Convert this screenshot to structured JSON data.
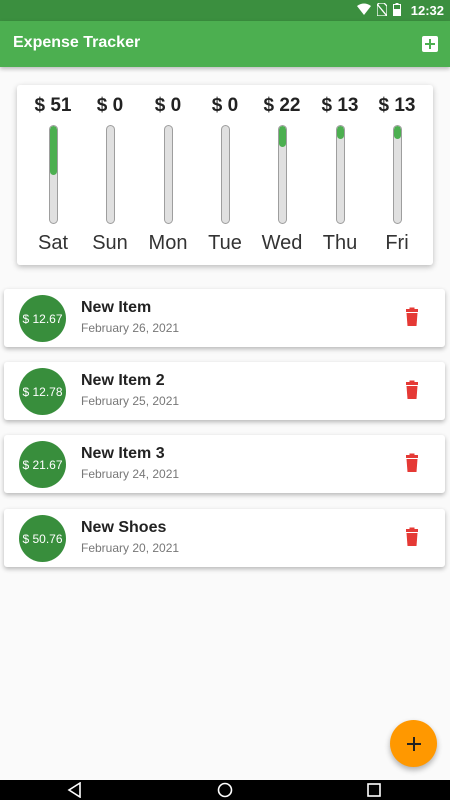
{
  "status_bar": {
    "time": "12:32",
    "icons": [
      "wifi-icon",
      "no-sim-icon",
      "battery-icon"
    ]
  },
  "app_bar": {
    "title": "Expense Tracker",
    "action_icon": "add-box-icon"
  },
  "colors": {
    "primary": "#4caf50",
    "dark_primary": "#388e3c",
    "accent": "#ff9800",
    "delete": "#e53935"
  },
  "chart": {
    "days": [
      {
        "day": "Sat",
        "amount": "$ 51",
        "fraction": 0.5
      },
      {
        "day": "Sun",
        "amount": "$ 0",
        "fraction": 0
      },
      {
        "day": "Mon",
        "amount": "$ 0",
        "fraction": 0
      },
      {
        "day": "Tue",
        "amount": "$ 0",
        "fraction": 0
      },
      {
        "day": "Wed",
        "amount": "$ 22",
        "fraction": 0.22
      },
      {
        "day": "Thu",
        "amount": "$ 13",
        "fraction": 0.13
      },
      {
        "day": "Fri",
        "amount": "$ 13",
        "fraction": 0.13
      }
    ]
  },
  "transactions": [
    {
      "amount": "$ 12.67",
      "title": "New Item",
      "date": "February 26, 2021"
    },
    {
      "amount": "$ 12.78",
      "title": "New Item 2",
      "date": "February 25, 2021"
    },
    {
      "amount": "$ 21.67",
      "title": "New Item 3",
      "date": "February 24, 2021"
    },
    {
      "amount": "$ 50.76",
      "title": "New Shoes",
      "date": "February 20, 2021"
    }
  ],
  "fab": {
    "icon": "plus-icon"
  },
  "nav": {
    "icons": [
      "back-icon",
      "home-icon",
      "recents-icon"
    ]
  }
}
